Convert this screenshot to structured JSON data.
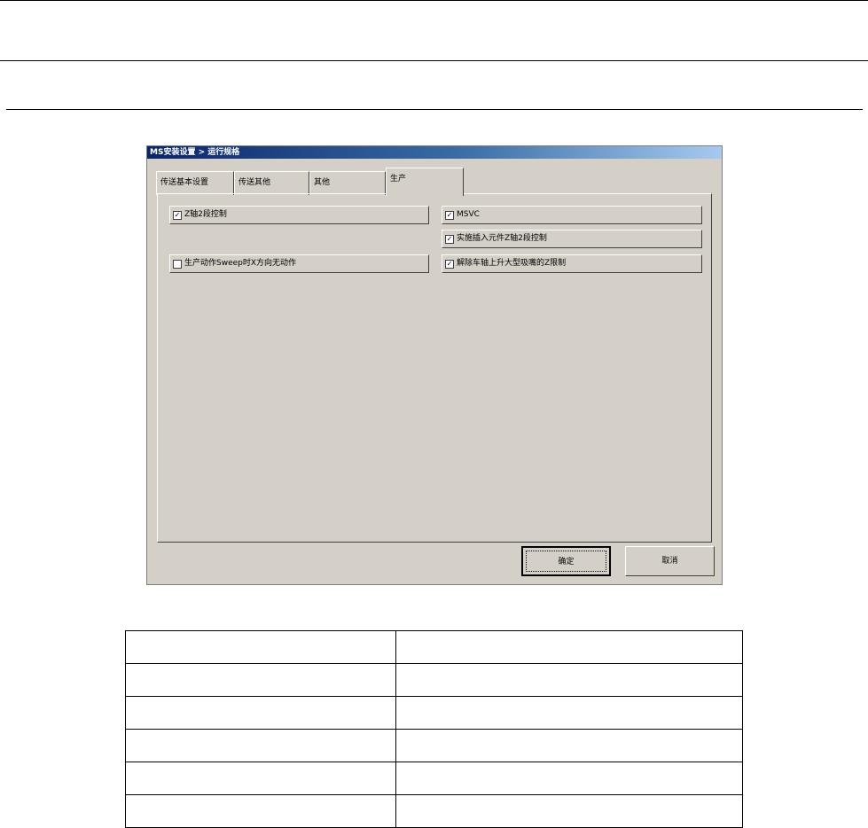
{
  "dialog": {
    "title": "MS安装设置 > 运行规格",
    "tabs": [
      {
        "label": "传送基本设置",
        "active": false
      },
      {
        "label": "传送其他",
        "active": false
      },
      {
        "label": "其他",
        "active": false
      },
      {
        "label": "生产",
        "active": true
      }
    ],
    "checkboxes": [
      {
        "label": "Z轴2段控制",
        "checked": true
      },
      {
        "label": "MSVC",
        "checked": true
      },
      {
        "label": "实施插入元件Z轴2段控制",
        "checked": true
      },
      {
        "label": "生产动作Sweep时X方向无动作",
        "checked": false
      },
      {
        "label": "解除车轴上升大型吸嘴的Z限制",
        "checked": true
      }
    ],
    "buttons": {
      "ok": "确定",
      "cancel": "取消"
    },
    "colors": {
      "face": "#d4d0c8",
      "title_start": "#0a246a",
      "title_end": "#a6caf0"
    }
  },
  "table": {
    "rows": [
      [
        "",
        ""
      ],
      [
        "",
        ""
      ],
      [
        "",
        ""
      ],
      [
        "",
        ""
      ],
      [
        "",
        ""
      ],
      [
        "",
        ""
      ]
    ]
  }
}
